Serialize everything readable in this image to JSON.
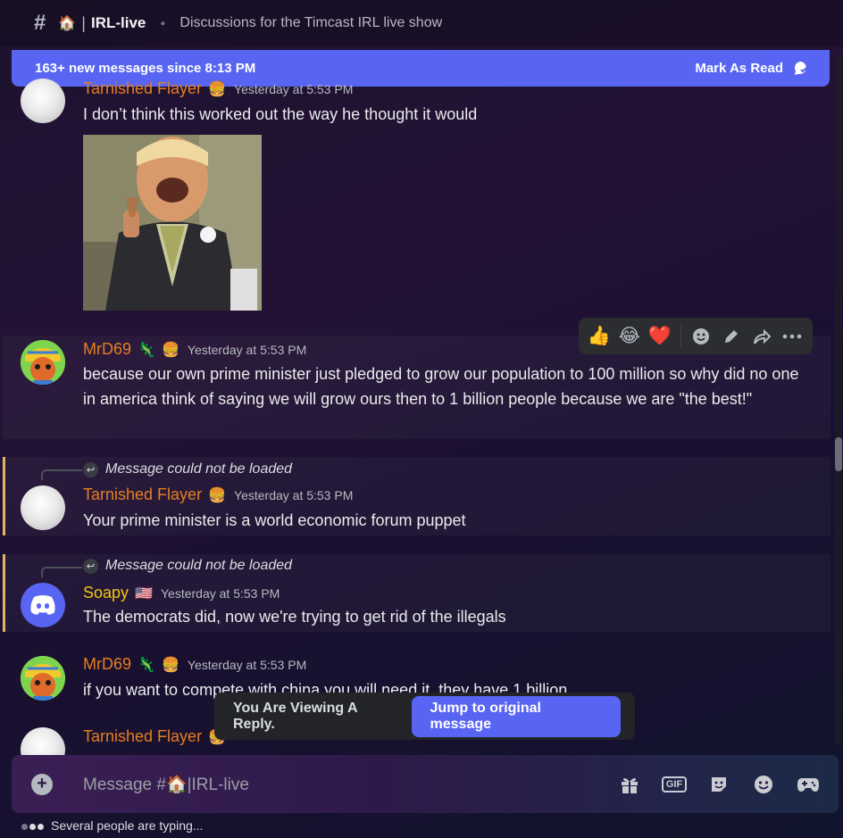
{
  "header": {
    "channel_emoji": "🏠",
    "channel_name": "IRL-live",
    "topic": "Discussions for the Timcast IRL live show"
  },
  "new_messages_bar": {
    "text": "163+ new messages since 8:13 PM",
    "mark_read_label": "Mark As Read"
  },
  "messages": [
    {
      "author": "Tarnished Flayer",
      "author_color": "#e67e22",
      "badges": [
        "🍔"
      ],
      "timestamp": "Yesterday at 5:53 PM",
      "text": "I don’t think this worked out the way he thought it would",
      "has_image": true
    },
    {
      "author": "MrD69",
      "author_color": "#e67e22",
      "badges": [
        "🦎",
        "🍔"
      ],
      "timestamp": "Yesterday at 5:53 PM",
      "text": "because our own prime minister just pledged to grow our population to 100 million so why did no one in america think of saying we will grow ours then to 1 billion people because we are \"the best!\""
    },
    {
      "reply_ref": "Message could not be loaded",
      "author": "Tarnished Flayer",
      "author_color": "#e67e22",
      "badges": [
        "🍔"
      ],
      "timestamp": "Yesterday at 5:53 PM",
      "text": "Your prime minister is a world economic forum puppet"
    },
    {
      "reply_ref": "Message could not be loaded",
      "author": "Soapy",
      "author_color": "#f1c40f",
      "badges": [
        "🇺🇸"
      ],
      "timestamp": "Yesterday at 5:53 PM",
      "text": "The democrats did, now we're trying to get rid of the illegals"
    },
    {
      "author": "MrD69",
      "author_color": "#e67e22",
      "badges": [
        "🦎",
        "🍔"
      ],
      "timestamp": "Yesterday at 5:53 PM",
      "text": "if you want to compete with china you will need it. they have 1 billion"
    },
    {
      "author": "Tarnished Flayer",
      "author_color": "#e67e22",
      "badges": [
        "🍔"
      ]
    }
  ],
  "toolbar": {
    "reactions": [
      "👍",
      "😂",
      "❤️"
    ]
  },
  "reply_popup": {
    "text": "You Are Viewing A Reply.",
    "button_label": "Jump to original message"
  },
  "composer": {
    "placeholder": "Message #🏠|IRL-live",
    "icons": [
      "gift-icon",
      "gif-icon",
      "sticker-icon",
      "emoji-icon",
      "activities-icon"
    ],
    "gif_label": "GIF"
  },
  "typing": {
    "text": "Several people are typing..."
  }
}
